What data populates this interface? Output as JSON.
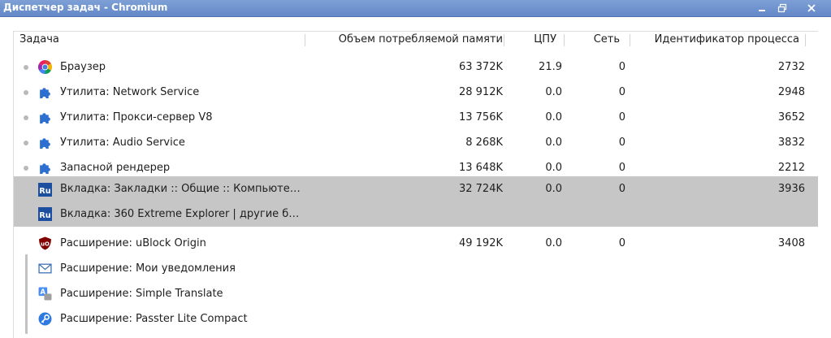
{
  "window": {
    "title": "Диспетчер задач - Chromium",
    "buttons": [
      "minimize-icon",
      "maximize-icon",
      "close-icon"
    ]
  },
  "table": {
    "columns": {
      "task": "Задача",
      "memory": "Объем потребляемой памяти",
      "cpu": "ЦПУ",
      "network": "Сеть",
      "pid": "Идентификатор процесса"
    },
    "rows": [
      {
        "icon": "chromium-logo-icon",
        "name": "Браузер",
        "memory": "63 372K",
        "cpu": "21.9",
        "network": "0",
        "pid": "2732"
      },
      {
        "icon": "puzzle-piece-icon",
        "name": "Утилита: Network Service",
        "memory": "28 912K",
        "cpu": "0.0",
        "network": "0",
        "pid": "2948"
      },
      {
        "icon": "puzzle-piece-icon",
        "name": "Утилита: Прокси-сервер V8",
        "memory": "13 756K",
        "cpu": "0.0",
        "network": "0",
        "pid": "3652"
      },
      {
        "icon": "puzzle-piece-icon",
        "name": "Утилита: Audio Service",
        "memory": "8 268K",
        "cpu": "0.0",
        "network": "0",
        "pid": "3832"
      },
      {
        "icon": "puzzle-piece-icon",
        "name": "Запасной рендерер",
        "memory": "13 648K",
        "cpu": "0.0",
        "network": "0",
        "pid": "2212"
      },
      {
        "icon": "ru-favicon-icon",
        "name": "Вкладка: Закладки :: Общие :: Компьюте…",
        "memory": "32 724K",
        "cpu": "0.0",
        "network": "0",
        "pid": "3936",
        "selected": true
      },
      {
        "icon": "ru-favicon-icon",
        "name": "Вкладка: 360 Extreme Explorer | другие б…",
        "memory": "",
        "cpu": "",
        "network": "",
        "pid": "",
        "selected": true
      },
      {
        "icon": "ublock-shield-icon",
        "name": "Расширение: uBlock Origin",
        "memory": "49 192K",
        "cpu": "0.0",
        "network": "0",
        "pid": "3408"
      },
      {
        "icon": "envelope-icon",
        "name": "Расширение: Мои уведомления",
        "memory": "",
        "cpu": "",
        "network": "",
        "pid": ""
      },
      {
        "icon": "translate-icon",
        "name": "Расширение: Simple Translate",
        "memory": "",
        "cpu": "",
        "network": "",
        "pid": ""
      },
      {
        "icon": "key-icon",
        "name": "Расширение: Passter Lite Compact",
        "memory": "",
        "cpu": "",
        "network": "",
        "pid": ""
      }
    ]
  },
  "colors": {
    "titlebar": "#6f93cf",
    "selected_row": "#c6c6c6",
    "ru_favicon": "#1c4fa0"
  }
}
